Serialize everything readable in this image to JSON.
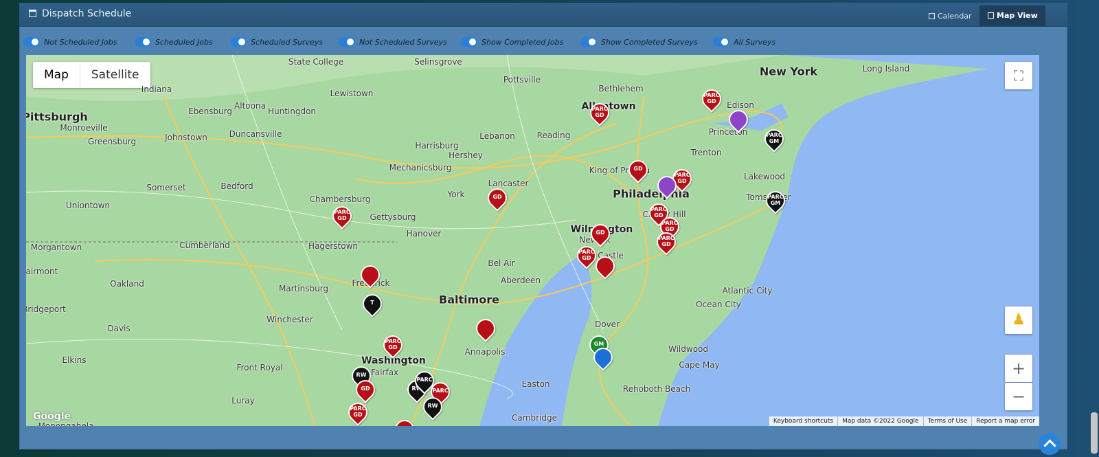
{
  "header": {
    "title": "Dispatch Schedule",
    "tabs": [
      {
        "label": "Calendar",
        "active": false,
        "icon": "calendar-icon"
      },
      {
        "label": "Map View",
        "active": true,
        "icon": "map-icon"
      }
    ]
  },
  "filters": [
    {
      "label": "Not Scheduled Jobs",
      "on": true
    },
    {
      "label": "Scheduled Jobs",
      "on": true
    },
    {
      "label": "Scheduled Surveys",
      "on": true
    },
    {
      "label": "Not Scheduled Surveys",
      "on": true
    },
    {
      "label": "Show Completed Jobs",
      "on": true
    },
    {
      "label": "Show Completed Surveys",
      "on": true
    },
    {
      "label": "All Surveys",
      "on": true
    }
  ],
  "map": {
    "type_buttons": {
      "map": "Map",
      "satellite": "Satellite"
    },
    "attribution": [
      "Keyboard shortcuts",
      "Map data ©2022 Google",
      "Terms of Use",
      "Report a map error"
    ],
    "logo": "Google",
    "cities": [
      {
        "name": "New York",
        "size": "big"
      },
      {
        "name": "Philadelphia",
        "size": "big"
      },
      {
        "name": "Baltimore",
        "size": "big"
      },
      {
        "name": "Pittsburgh",
        "size": "big"
      },
      {
        "name": "Allentown",
        "size": "mid"
      },
      {
        "name": "Wilmington",
        "size": "mid"
      },
      {
        "name": "Washington",
        "size": "mid"
      },
      {
        "name": "State College",
        "size": "small"
      },
      {
        "name": "Selinsgrove",
        "size": "small"
      },
      {
        "name": "Pottsville",
        "size": "small"
      },
      {
        "name": "Bethlehem",
        "size": "small"
      },
      {
        "name": "Long Island",
        "size": "small"
      },
      {
        "name": "Indiana",
        "size": "small"
      },
      {
        "name": "Lewistown",
        "size": "small"
      },
      {
        "name": "Ebensburg",
        "size": "small"
      },
      {
        "name": "Altoona",
        "size": "small"
      },
      {
        "name": "Huntingdon",
        "size": "small"
      },
      {
        "name": "Monroeville",
        "size": "small"
      },
      {
        "name": "Greensburg",
        "size": "small"
      },
      {
        "name": "Johnstown",
        "size": "small"
      },
      {
        "name": "Duncansville",
        "size": "small"
      },
      {
        "name": "Lebanon",
        "size": "small"
      },
      {
        "name": "Reading",
        "size": "small"
      },
      {
        "name": "Princeton",
        "size": "small"
      },
      {
        "name": "Edison",
        "size": "small"
      },
      {
        "name": "Harrisburg",
        "size": "small"
      },
      {
        "name": "Hershey",
        "size": "small"
      },
      {
        "name": "Mechanicsburg",
        "size": "small"
      },
      {
        "name": "Lancaster",
        "size": "small"
      },
      {
        "name": "King of Prussia",
        "size": "small"
      },
      {
        "name": "Trenton",
        "size": "small"
      },
      {
        "name": "Lakewood",
        "size": "small"
      },
      {
        "name": "Toms River",
        "size": "small"
      },
      {
        "name": "Somerset",
        "size": "small"
      },
      {
        "name": "Bedford",
        "size": "small"
      },
      {
        "name": "Chambersburg",
        "size": "small"
      },
      {
        "name": "York",
        "size": "small"
      },
      {
        "name": "Uniontown",
        "size": "small"
      },
      {
        "name": "Gettysburg",
        "size": "small"
      },
      {
        "name": "Cherry Hill",
        "size": "small"
      },
      {
        "name": "Morgantown",
        "size": "small"
      },
      {
        "name": "Cumberland",
        "size": "small"
      },
      {
        "name": "Hagerstown",
        "size": "small"
      },
      {
        "name": "Hanover",
        "size": "small"
      },
      {
        "name": "Newark",
        "size": "small"
      },
      {
        "name": "New Castle",
        "size": "small"
      },
      {
        "name": "Bel Air",
        "size": "small"
      },
      {
        "name": "Aberdeen",
        "size": "small"
      },
      {
        "name": "Fairmont",
        "size": "small"
      },
      {
        "name": "Oakland",
        "size": "small"
      },
      {
        "name": "Martinsburg",
        "size": "small"
      },
      {
        "name": "Frederick",
        "size": "small"
      },
      {
        "name": "Atlantic City",
        "size": "small"
      },
      {
        "name": "Ocean City",
        "size": "small"
      },
      {
        "name": "Bridgeport",
        "size": "small"
      },
      {
        "name": "Winchester",
        "size": "small"
      },
      {
        "name": "Davis",
        "size": "small"
      },
      {
        "name": "Annapolis",
        "size": "small"
      },
      {
        "name": "Dover",
        "size": "small"
      },
      {
        "name": "Elkins",
        "size": "small"
      },
      {
        "name": "Front Royal",
        "size": "small"
      },
      {
        "name": "Fairfax",
        "size": "small"
      },
      {
        "name": "Wildwood",
        "size": "small"
      },
      {
        "name": "Cape May",
        "size": "small"
      },
      {
        "name": "Easton",
        "size": "small"
      },
      {
        "name": "Rehoboth Beach",
        "size": "small"
      },
      {
        "name": "Luray",
        "size": "small"
      },
      {
        "name": "Cambridge",
        "size": "small"
      },
      {
        "name": "Monongahela",
        "size": "small"
      }
    ],
    "markers": [
      {
        "label": "PARC GD",
        "color": "#b80f16"
      },
      {
        "label": "PARC GD",
        "color": "#b80f16"
      },
      {
        "label": "PARC GM",
        "color": "#111111"
      },
      {
        "label": "GD",
        "color": "#b80f16"
      },
      {
        "label": "PARC GD",
        "color": "#b80f16"
      },
      {
        "label": "PARC GM",
        "color": "#111111"
      },
      {
        "label": "GD",
        "color": "#b80f16"
      },
      {
        "label": "PARC GD",
        "color": "#b80f16"
      },
      {
        "label": "PARC GD",
        "color": "#b80f16"
      },
      {
        "label": "PARC GD",
        "color": "#b80f16"
      },
      {
        "label": "PARC GD",
        "color": "#b80f16"
      },
      {
        "label": "GD",
        "color": "#b80f16"
      },
      {
        "label": "PARC GD",
        "color": "#b80f16"
      },
      {
        "label": "T",
        "color": "#111111"
      },
      {
        "label": "PARC GD",
        "color": "#b80f16"
      },
      {
        "label": "GM",
        "color": "#1f8a2d"
      },
      {
        "label": "RW",
        "color": "#111111"
      },
      {
        "label": "GD",
        "color": "#b80f16"
      },
      {
        "label": "PARC GD",
        "color": "#b80f16"
      },
      {
        "label": "RW",
        "color": "#111111"
      },
      {
        "label": "PARC",
        "color": "#111111"
      },
      {
        "label": "PARC",
        "color": "#b80f16"
      },
      {
        "label": "GD",
        "color": "#b80f16"
      },
      {
        "label": "RW",
        "color": "#111111"
      },
      {
        "label": "PARC",
        "color": "#b80f16"
      },
      {
        "label": "",
        "color": "#b80f16"
      },
      {
        "label": "",
        "color": "#b80f16"
      },
      {
        "label": "",
        "color": "#b80f16"
      },
      {
        "label": "",
        "color": "#8e44c9"
      },
      {
        "label": "",
        "color": "#8e44c9"
      },
      {
        "label": "",
        "color": "#1c6fd6"
      },
      {
        "label": "",
        "color": "#1c6fd6"
      }
    ]
  }
}
